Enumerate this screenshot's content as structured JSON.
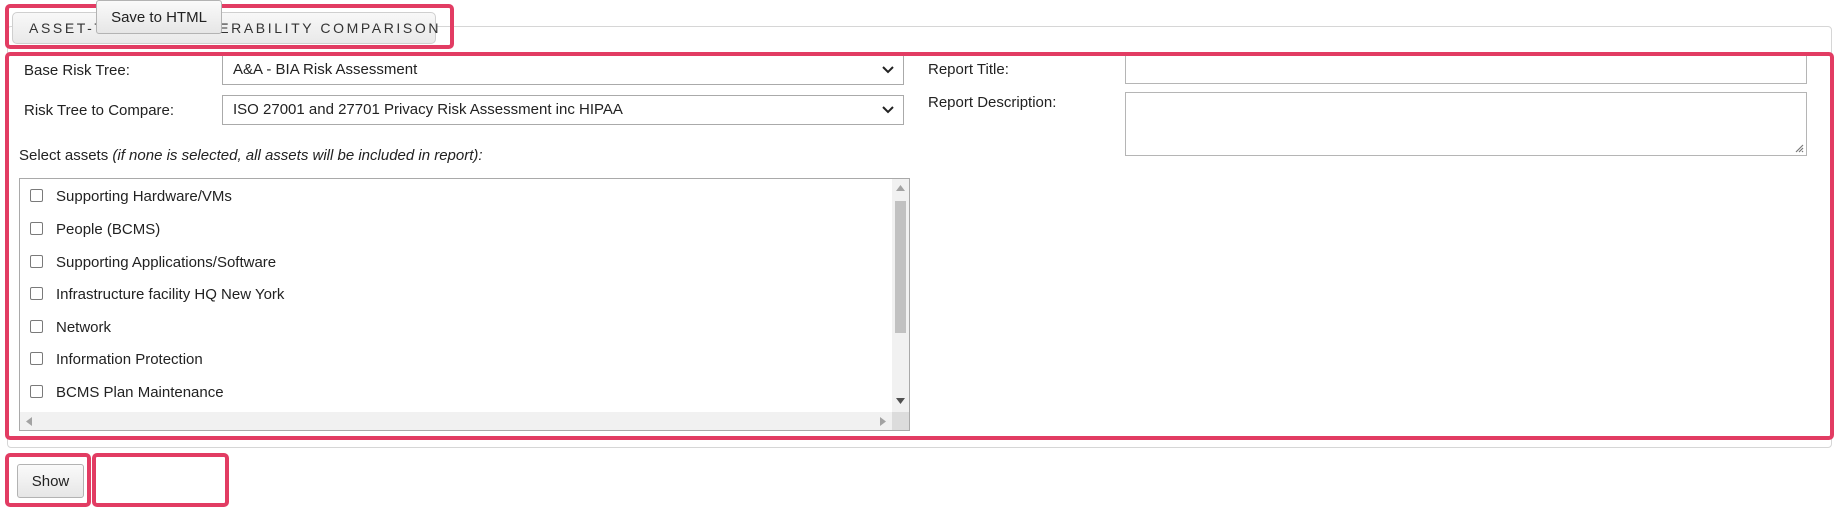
{
  "section": {
    "legend": "ASSET-THREAT-VULNERABILITY COMPARISON"
  },
  "form": {
    "base_tree_label": "Base Risk Tree:",
    "base_tree_value": "A&A - BIA Risk Assessment",
    "compare_tree_label": "Risk Tree to Compare:",
    "compare_tree_value": "ISO 27001 and 27701 Privacy Risk Assessment inc HIPAA",
    "select_assets_label": "Select assets",
    "select_assets_hint": "(if none is selected, all assets will be included in report):",
    "report_title_label": "Report Title:",
    "report_title_value": "",
    "report_description_label": "Report Description:",
    "report_description_value": ""
  },
  "assets": [
    {
      "label": "Supporting Hardware/VMs",
      "checked": false
    },
    {
      "label": "People (BCMS)",
      "checked": false
    },
    {
      "label": "Supporting Applications/Software",
      "checked": false
    },
    {
      "label": "Infrastructure facility HQ New York",
      "checked": false
    },
    {
      "label": "Network",
      "checked": false
    },
    {
      "label": "Information Protection",
      "checked": false
    },
    {
      "label": "BCMS Plan Maintenance",
      "checked": false
    }
  ],
  "actions": {
    "show_label": "Show",
    "save_label": "Save to HTML"
  },
  "colors": {
    "highlight": "#e23c63",
    "border": "#aaaaaa"
  }
}
